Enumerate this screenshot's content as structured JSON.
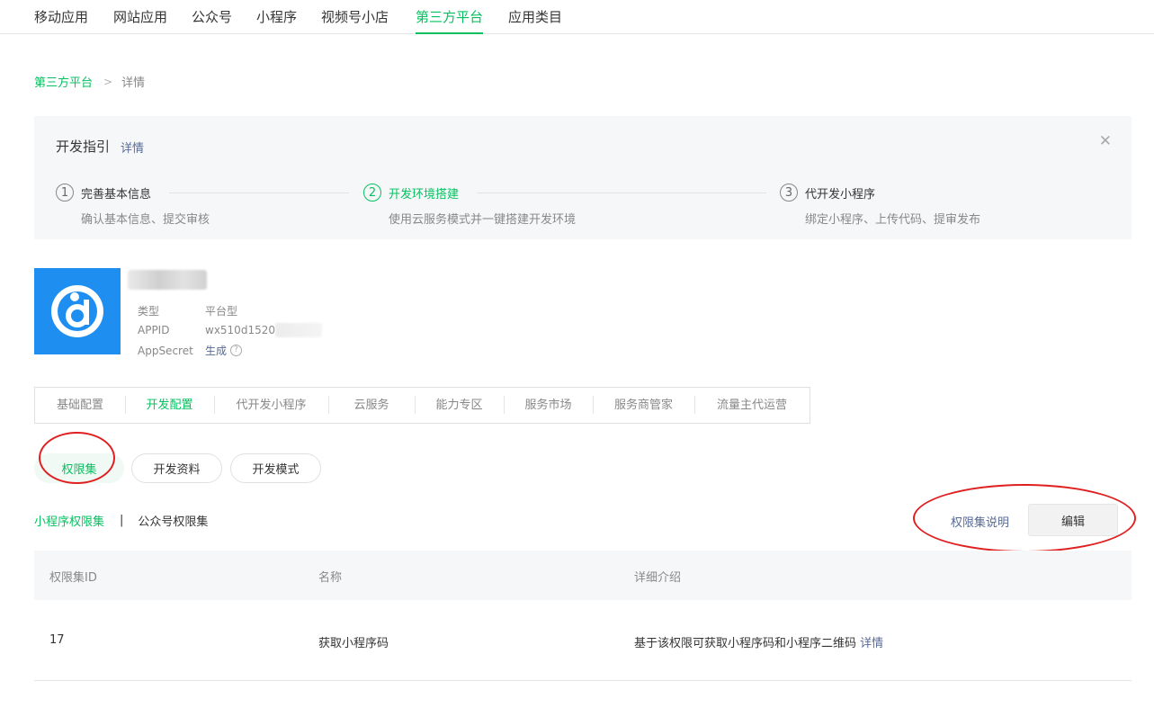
{
  "topnav": {
    "tabs": [
      {
        "label": "移动应用"
      },
      {
        "label": "网站应用"
      },
      {
        "label": "公众号"
      },
      {
        "label": "小程序"
      },
      {
        "label": "视频号小店"
      },
      {
        "label": "第三方平台",
        "active": true
      },
      {
        "label": "应用类目"
      }
    ]
  },
  "breadcrumb": {
    "parent": "第三方平台",
    "separator": ">",
    "current": "详情"
  },
  "guide": {
    "title": "开发指引",
    "detail_link": "详情",
    "close_icon": "close-icon",
    "steps": [
      {
        "num": "1",
        "name": "完善基本信息",
        "desc": "确认基本信息、提交审核"
      },
      {
        "num": "2",
        "name": "开发环境搭建",
        "desc": "使用云服务模式并一键搭建开发环境",
        "active": true
      },
      {
        "num": "3",
        "name": "代开发小程序",
        "desc": "绑定小程序、上传代码、提审发布"
      }
    ]
  },
  "app": {
    "type_label": "类型",
    "type_value": "平台型",
    "appid_label": "APPID",
    "appid_value": "wx510d1520",
    "secret_label": "AppSecret",
    "secret_action": "生成",
    "help_icon": "?"
  },
  "subtabs": [
    {
      "label": "基础配置"
    },
    {
      "label": "开发配置",
      "active": true
    },
    {
      "label": "代开发小程序"
    },
    {
      "label": "云服务"
    },
    {
      "label": "能力专区"
    },
    {
      "label": "服务市场"
    },
    {
      "label": "服务商管家"
    },
    {
      "label": "流量主代运营"
    }
  ],
  "pills": [
    {
      "label": "权限集",
      "active": true
    },
    {
      "label": "开发资料"
    },
    {
      "label": "开发模式"
    }
  ],
  "permissions": {
    "tabs": [
      {
        "label": "小程序权限集",
        "active": true
      },
      {
        "label": "公众号权限集"
      }
    ],
    "separator": "|",
    "explain_link": "权限集说明",
    "edit_label": "编辑"
  },
  "table": {
    "headers": [
      "权限集ID",
      "名称",
      "详细介绍"
    ],
    "rows": [
      {
        "id": "17",
        "name": "获取小程序码",
        "desc": "基于该权限可获取小程序码和小程序二维码",
        "link": "详情"
      }
    ]
  },
  "colors": {
    "brand_green": "#07c160",
    "link_blue": "#576b95",
    "annotation_red": "#e02020",
    "logo_blue": "#1e8ff0"
  }
}
